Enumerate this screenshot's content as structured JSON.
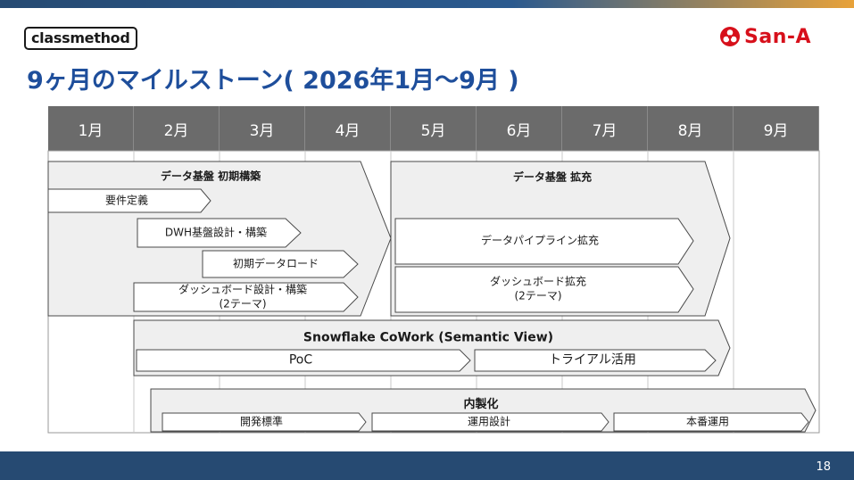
{
  "header": {
    "logo_left": "classmethod",
    "logo_right": "San-A",
    "title": "9ヶ月のマイルストーン( 2026年1月～9月 )"
  },
  "months": [
    "1月",
    "2月",
    "3月",
    "4月",
    "5月",
    "6月",
    "7月",
    "8月",
    "9月"
  ],
  "phases": {
    "initial": {
      "title": "データ基盤 初期構築",
      "tasks": {
        "requirements": "要件定義",
        "dwh": "DWH基盤設計・構築",
        "initial_load": "初期データロード",
        "dashboard_l1": "ダッシュボード設計・構築",
        "dashboard_l2": "(2テーマ)"
      }
    },
    "expansion": {
      "title": "データ基盤 拡充",
      "tasks": {
        "pipeline": "データパイプライン拡充",
        "dashboard_l1": "ダッシュボード拡充",
        "dashboard_l2": "(2テーマ)"
      }
    },
    "snowflake": {
      "title": "Snowflake CoWork (Semantic View)",
      "tasks": {
        "poc": "PoC",
        "trial": "トライアル活用"
      }
    },
    "inhouse": {
      "title": "内製化",
      "tasks": {
        "dev_standard": "開発標準",
        "ops_design": "運用設計",
        "production": "本番運用"
      }
    }
  },
  "footer": {
    "page_number": "18"
  },
  "colors": {
    "title_blue": "#1e4e9b",
    "bar_navy": "#264a72",
    "header_gray": "#6b6b6b",
    "phase_fill": "#efefef",
    "brand_red": "#d7101b"
  }
}
